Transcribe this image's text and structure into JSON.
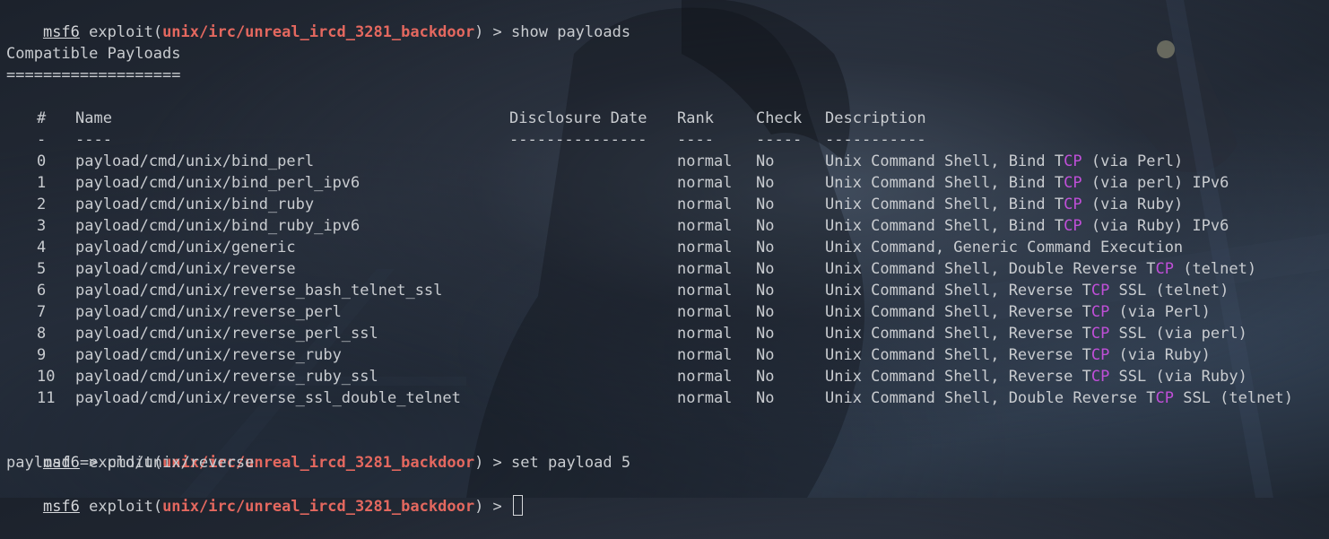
{
  "prompts": [
    {
      "user": "msf6",
      "cmd_word": "exploit",
      "module": "unix/irc/unreal_ircd_3281_backdoor",
      "command": "show payloads"
    },
    {
      "user": "msf6",
      "cmd_word": "exploit",
      "module": "unix/irc/unreal_ircd_3281_backdoor",
      "command": "set payload 5"
    },
    {
      "user": "msf6",
      "cmd_word": "exploit",
      "module": "unix/irc/unreal_ircd_3281_backdoor",
      "command": ""
    }
  ],
  "prompt_separator": " > ",
  "section_title": "Compatible Payloads",
  "section_underline": "===================",
  "table": {
    "headers": {
      "num": "#",
      "name": "Name",
      "date": "Disclosure Date",
      "rank": "Rank",
      "check": "Check",
      "desc": "Description"
    },
    "dashes": {
      "num": "-",
      "name": "----",
      "date": "---------------",
      "rank": "----",
      "check": "-----",
      "desc": "-----------"
    },
    "rows": [
      {
        "num": "0",
        "name": "payload/cmd/unix/bind_perl",
        "date": "",
        "rank": "normal",
        "check": "No",
        "desc_pre": "Unix Command Shell, Bind ",
        "desc_t": "T",
        "desc_cp": "CP",
        "desc_post": " (via Perl)"
      },
      {
        "num": "1",
        "name": "payload/cmd/unix/bind_perl_ipv6",
        "date": "",
        "rank": "normal",
        "check": "No",
        "desc_pre": "Unix Command Shell, Bind ",
        "desc_t": "T",
        "desc_cp": "CP",
        "desc_post": " (via perl) IPv6"
      },
      {
        "num": "2",
        "name": "payload/cmd/unix/bind_ruby",
        "date": "",
        "rank": "normal",
        "check": "No",
        "desc_pre": "Unix Command Shell, Bind ",
        "desc_t": "T",
        "desc_cp": "CP",
        "desc_post": " (via Ruby)"
      },
      {
        "num": "3",
        "name": "payload/cmd/unix/bind_ruby_ipv6",
        "date": "",
        "rank": "normal",
        "check": "No",
        "desc_pre": "Unix Command Shell, Bind ",
        "desc_t": "T",
        "desc_cp": "CP",
        "desc_post": " (via Ruby) IPv6"
      },
      {
        "num": "4",
        "name": "payload/cmd/unix/generic",
        "date": "",
        "rank": "normal",
        "check": "No",
        "desc_pre": "Unix Command, Generic Command Execution",
        "desc_t": "",
        "desc_cp": "",
        "desc_post": ""
      },
      {
        "num": "5",
        "name": "payload/cmd/unix/reverse",
        "date": "",
        "rank": "normal",
        "check": "No",
        "desc_pre": "Unix Command Shell, Double Reverse ",
        "desc_t": "T",
        "desc_cp": "CP",
        "desc_post": " (telnet)"
      },
      {
        "num": "6",
        "name": "payload/cmd/unix/reverse_bash_telnet_ssl",
        "date": "",
        "rank": "normal",
        "check": "No",
        "desc_pre": "Unix Command Shell, Reverse ",
        "desc_t": "T",
        "desc_cp": "CP",
        "desc_post": " SSL (telnet)"
      },
      {
        "num": "7",
        "name": "payload/cmd/unix/reverse_perl",
        "date": "",
        "rank": "normal",
        "check": "No",
        "desc_pre": "Unix Command Shell, Reverse ",
        "desc_t": "T",
        "desc_cp": "CP",
        "desc_post": " (via Perl)"
      },
      {
        "num": "8",
        "name": "payload/cmd/unix/reverse_perl_ssl",
        "date": "",
        "rank": "normal",
        "check": "No",
        "desc_pre": "Unix Command Shell, Reverse ",
        "desc_t": "T",
        "desc_cp": "CP",
        "desc_post": " SSL (via perl)"
      },
      {
        "num": "9",
        "name": "payload/cmd/unix/reverse_ruby",
        "date": "",
        "rank": "normal",
        "check": "No",
        "desc_pre": "Unix Command Shell, Reverse ",
        "desc_t": "T",
        "desc_cp": "CP",
        "desc_post": " (via Ruby)"
      },
      {
        "num": "10",
        "name": "payload/cmd/unix/reverse_ruby_ssl",
        "date": "",
        "rank": "normal",
        "check": "No",
        "desc_pre": "Unix Command Shell, Reverse ",
        "desc_t": "T",
        "desc_cp": "CP",
        "desc_post": " SSL (via Ruby)"
      },
      {
        "num": "11",
        "name": "payload/cmd/unix/reverse_ssl_double_telnet",
        "date": "",
        "rank": "normal",
        "check": "No",
        "desc_pre": "Unix Command Shell, Double Reverse ",
        "desc_t": "T",
        "desc_cp": "CP",
        "desc_post": " SSL (telnet)"
      }
    ]
  },
  "output_line": "payload => cmd/unix/reverse",
  "colors": {
    "background": "#232a35",
    "text": "#c9ccd0",
    "module": "#e4685f",
    "highlight": "#c04fd8"
  }
}
